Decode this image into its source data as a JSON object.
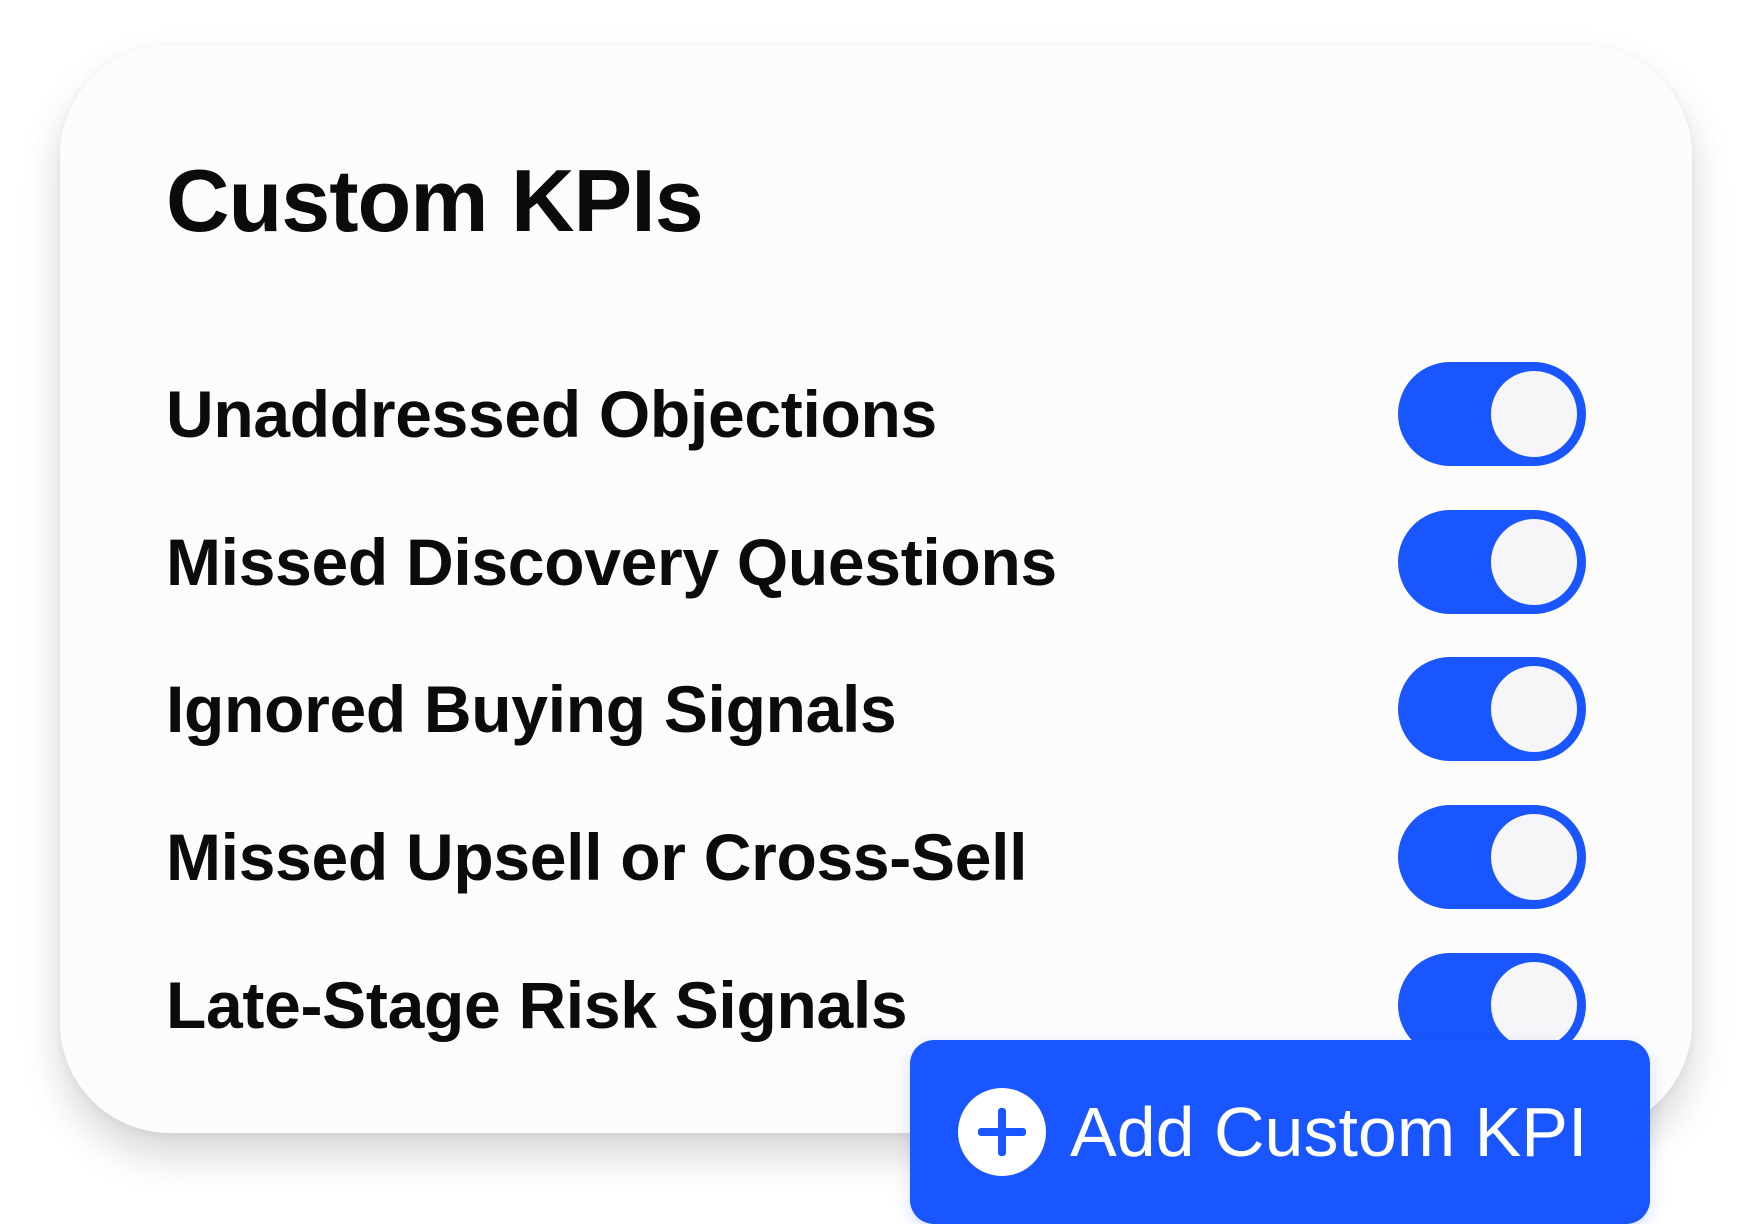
{
  "panel": {
    "title": "Custom KPIs",
    "accent_color": "#1a56ff",
    "kpis": [
      {
        "label": "Unaddressed Objections",
        "enabled": true
      },
      {
        "label": "Missed Discovery Questions",
        "enabled": true
      },
      {
        "label": "Ignored Buying Signals",
        "enabled": true
      },
      {
        "label": "Missed Upsell or Cross-Sell",
        "enabled": true
      },
      {
        "label": "Late-Stage Risk Signals",
        "enabled": true
      }
    ]
  },
  "add_button": {
    "label": "Add Custom KPI",
    "icon": "plus-circle-icon"
  }
}
